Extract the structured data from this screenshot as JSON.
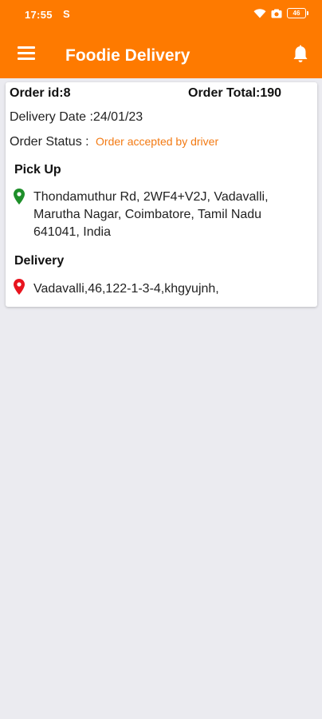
{
  "status_bar": {
    "time": "17:55",
    "extra": "S",
    "battery": "46"
  },
  "app_bar": {
    "title": "Foodie Delivery",
    "menu_icon": "hamburger-menu-icon",
    "notification_icon": "bell-icon"
  },
  "colors": {
    "primary": "#fe7a00",
    "status_accent": "#f37a13",
    "pickup_pin": "#1e8f2a",
    "delivery_pin": "#e8141e",
    "background": "#ebebf0"
  },
  "order": {
    "id_text": "Order id:8",
    "total_text": "Order Total:190",
    "delivery_date_text": "Delivery Date :24/01/23",
    "status_label": "Order Status :",
    "status_value": "Order accepted by driver",
    "pickup": {
      "label": "Pick Up",
      "address": "Thondamuthur Rd, 2WF4+V2J, Vadavalli, Marutha Nagar, Coimbatore, Tamil Nadu 641041, India"
    },
    "delivery": {
      "label": "Delivery",
      "address": "Vadavalli,46,122-1-3-4,khgyujnh,"
    }
  }
}
